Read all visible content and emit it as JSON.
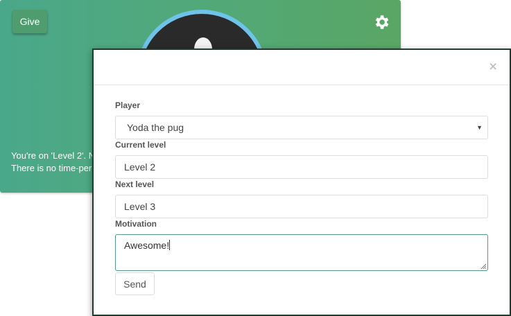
{
  "card": {
    "give_label": "Give",
    "text_line1": "You're on 'Level 2'. N",
    "text_line2": "There is no time-peri",
    "icons": {
      "settings": "gear-icon"
    }
  },
  "modal": {
    "close_symbol": "×",
    "player_label": "Player",
    "player_value": "Yoda the pug",
    "current_level_label": "Current level",
    "current_level_value": "Level 2",
    "next_level_label": "Next level",
    "next_level_value": "Level 3",
    "motivation_label": "Motivation",
    "motivation_value": "Awesome!",
    "send_label": "Send"
  },
  "colors": {
    "card_gradient_start": "#4aa88a",
    "card_gradient_end": "#5aa664",
    "avatar_ring": "#6fc3e8",
    "modal_border": "#1f3b2d",
    "textarea_focus": "#4f9c7e"
  }
}
